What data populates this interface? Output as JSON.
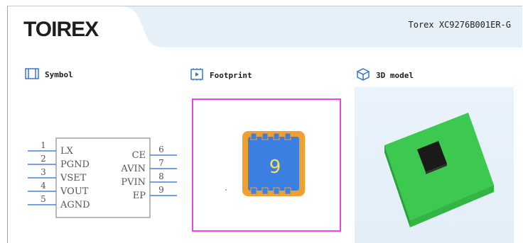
{
  "header": {
    "logo_text": "TOIREX",
    "part_number": "Torex XC9276B001ER-G"
  },
  "panels": {
    "symbol": {
      "title": "Symbol",
      "icon": "schematic-symbol-icon"
    },
    "footprint": {
      "title": "Footprint",
      "icon": "footprint-icon"
    },
    "model3d": {
      "title": "3D model",
      "icon": "cube-icon"
    }
  },
  "symbol": {
    "left_pins": [
      {
        "num": "1",
        "name": "LX"
      },
      {
        "num": "2",
        "name": "PGND"
      },
      {
        "num": "3",
        "name": "VSET"
      },
      {
        "num": "4",
        "name": "VOUT"
      },
      {
        "num": "5",
        "name": "AGND"
      }
    ],
    "right_pins": [
      {
        "num": "6",
        "name": "CE"
      },
      {
        "num": "7",
        "name": "AVIN"
      },
      {
        "num": "8",
        "name": "PVIN"
      },
      {
        "num": "9",
        "name": "EP"
      }
    ]
  },
  "footprint": {
    "pad_label": "9",
    "highlight_color": "#ee44ee",
    "pad_color": "#3b7fe0",
    "outline_color": "#f0a030"
  },
  "model3d": {
    "body_color": "#3dc94f",
    "chip_color": "#1a1a1a"
  }
}
